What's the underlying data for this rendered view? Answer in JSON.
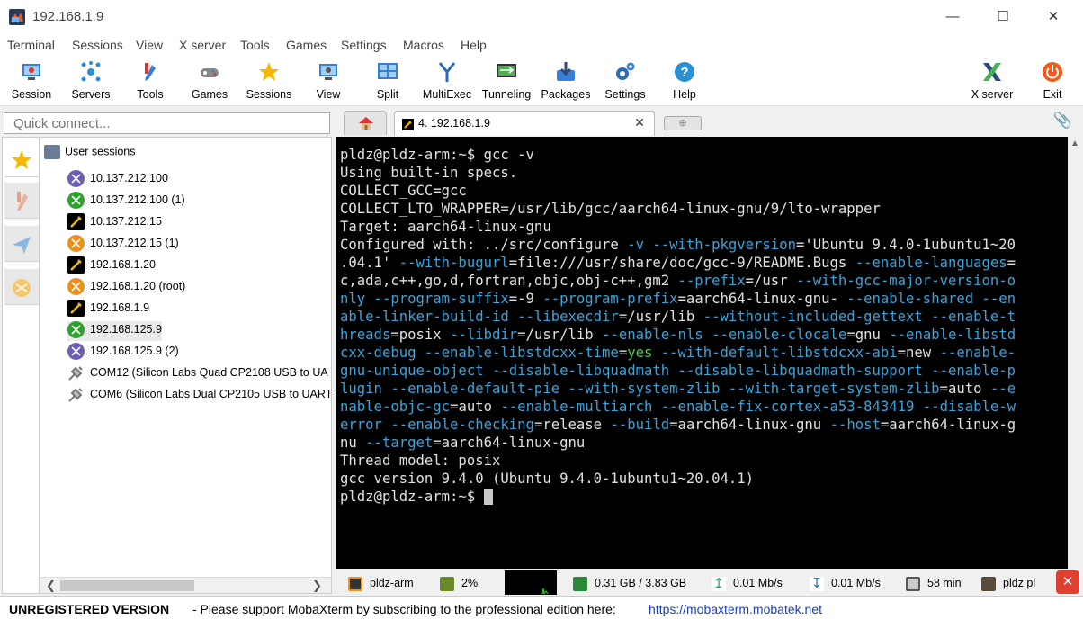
{
  "window": {
    "title": "192.168.1.9",
    "minimize": "—",
    "maximize": "☐",
    "close": "✕"
  },
  "menu": [
    "Terminal",
    "Sessions",
    "View",
    "X server",
    "Tools",
    "Games",
    "Settings",
    "Macros",
    "Help"
  ],
  "toolbar": {
    "left": [
      "Session",
      "Servers",
      "Tools",
      "Games",
      "Sessions",
      "View",
      "Split",
      "MultiExec",
      "Tunneling",
      "Packages",
      "Settings",
      "Help"
    ],
    "right": [
      "X server",
      "Exit"
    ]
  },
  "quick_connect": {
    "placeholder": "Quick connect..."
  },
  "tabs": {
    "active": "4. 192.168.1.9",
    "close": "✕"
  },
  "sessions": {
    "root": "User sessions",
    "items": [
      {
        "label": "10.137.212.100",
        "icon": "session-purple-icon",
        "color": "#6b5fb5"
      },
      {
        "label": "10.137.212.100 (1)",
        "icon": "session-green-icon",
        "color": "#2da32d"
      },
      {
        "label": "10.137.212.15",
        "icon": "ssh-key-icon",
        "color": "#000000"
      },
      {
        "label": "10.137.212.15 (1)",
        "icon": "session-orange-icon",
        "color": "#f0901a"
      },
      {
        "label": "192.168.1.20",
        "icon": "ssh-key-icon",
        "color": "#000000"
      },
      {
        "label": "192.168.1.20 (root)",
        "icon": "session-orange-icon",
        "color": "#f0901a"
      },
      {
        "label": "192.168.1.9",
        "icon": "ssh-key-icon",
        "color": "#000000"
      },
      {
        "label": "192.168.125.9",
        "icon": "session-green-icon",
        "color": "#2da32d"
      },
      {
        "label": "192.168.125.9 (2)",
        "icon": "session-purple-icon",
        "color": "#6b5fb5"
      },
      {
        "label": "COM12  (Silicon Labs Quad CP2108 USB to UA",
        "icon": "serial-plug-icon",
        "color": "#777777"
      },
      {
        "label": "COM6  (Silicon Labs Dual CP2105 USB to UART",
        "icon": "serial-plug-icon",
        "color": "#777777"
      }
    ]
  },
  "terminal": {
    "prompt1": "pldz@pldz-arm:~$ ",
    "cmd": "gcc -v",
    "prompt2": "pldz@pldz-arm:~$ "
  },
  "status": {
    "host": "pldz-arm",
    "cpu": "2%",
    "memory": "0.31 GB / 3.83 GB",
    "upload": "0.01 Mb/s",
    "download": "0.01 Mb/s",
    "uptime": "58 min",
    "user": "pldz  pl"
  },
  "footer": {
    "unregistered": "UNREGISTERED VERSION",
    "message": "-  Please support MobaXterm by subscribing to the professional edition here:",
    "link": "https://mobaxterm.mobatek.net"
  },
  "colors": {
    "accent_blue": "#2a6db5",
    "terminal_bg": "#000000",
    "option_cyan": "#3aa3d8",
    "green": "#4ec94e"
  }
}
